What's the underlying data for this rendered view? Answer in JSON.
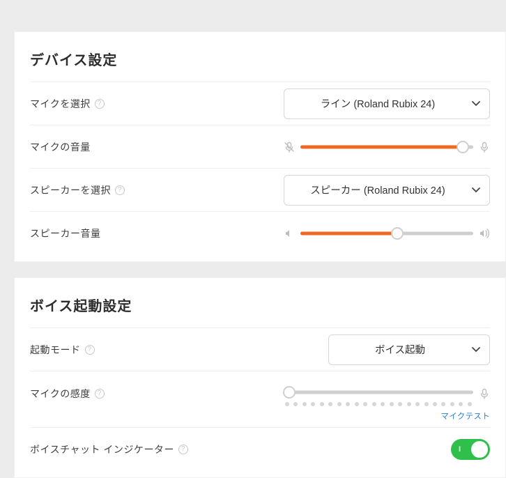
{
  "colors": {
    "accent": "#ee6a24",
    "toggle_on": "#2ec04b",
    "link": "#2d7fd1"
  },
  "device": {
    "title": "デバイス設定",
    "mic_select_label": "マイクを選択",
    "mic_select_value": "ライン (Roland Rubix 24)",
    "mic_volume_label": "マイクの音量",
    "mic_volume_pct": 94,
    "speaker_select_label": "スピーカーを選択",
    "speaker_select_value": "スピーカー (Roland Rubix 24)",
    "speaker_volume_label": "スピーカー音量",
    "speaker_volume_pct": 56
  },
  "voice": {
    "title": "ボイス起動設定",
    "mode_label": "起動モード",
    "mode_value": "ボイス起動",
    "sensitivity_label": "マイクの感度",
    "sensitivity_pct": 3,
    "sensitivity_dots": 22,
    "mic_test_label": "マイクテスト",
    "indicator_label": "ボイスチャット インジケーター",
    "indicator_on_label": "I",
    "indicator_on": true
  }
}
